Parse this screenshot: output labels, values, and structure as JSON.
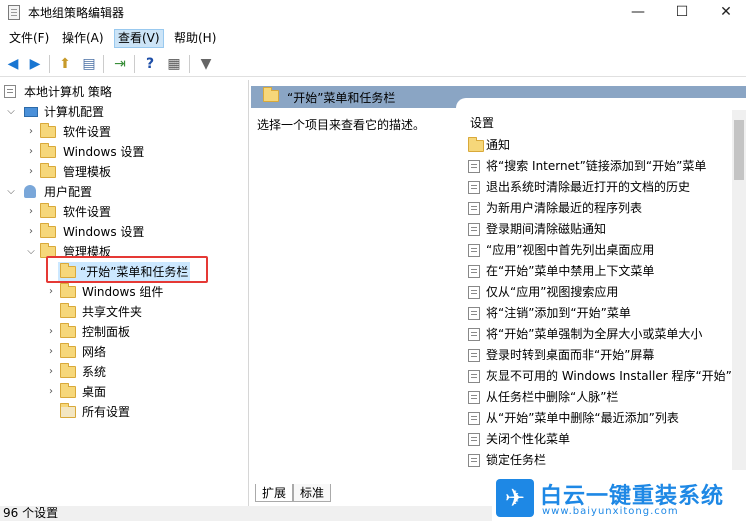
{
  "window": {
    "title": "本地组策略编辑器",
    "minimize": "—",
    "maximize": "☐",
    "close": "✕"
  },
  "menu": [
    "文件(F)",
    "操作(A)",
    "查看(V)",
    "帮助(H)"
  ],
  "tree": {
    "root": "本地计算机 策略",
    "computer": "计算机配置",
    "computer_children": [
      "软件设置",
      "Windows 设置",
      "管理模板"
    ],
    "user": "用户配置",
    "user_children": [
      "软件设置",
      "Windows 设置",
      "管理模板"
    ],
    "admin_children": [
      "“开始”菜单和任务栏",
      "Windows 组件",
      "共享文件夹",
      "控制面板",
      "网络",
      "系统",
      "桌面",
      "所有设置"
    ]
  },
  "right": {
    "header": "“开始”菜单和任务栏",
    "description": "选择一个项目来查看它的描述。",
    "column": "设置",
    "items": [
      "通知",
      "将“搜索 Internet”链接添加到“开始”菜单",
      "退出系统时清除最近打开的文档的历史",
      "为新用户清除最近的程序列表",
      "登录期间清除磁贴通知",
      "“应用”视图中首先列出桌面应用",
      "在“开始”菜单中禁用上下文菜单",
      "仅从“应用”视图搜索应用",
      "将“注销”添加到“开始”菜单",
      "将“开始”菜单强制为全屏大小或菜单大小",
      "登录时转到桌面而非“开始”屏幕",
      "灰显不可用的 Windows Installer 程序“开始”菜",
      "从任务栏中删除“人脉”栏",
      "从“开始”菜单中删除“最近添加”列表",
      "关闭个性化菜单",
      "锁定任务栏"
    ]
  },
  "tabs": [
    "扩展",
    "标准"
  ],
  "status": "96 个设置",
  "watermark": {
    "title": "白云一键重装系统",
    "url": "www.baiyunxitong.com"
  }
}
